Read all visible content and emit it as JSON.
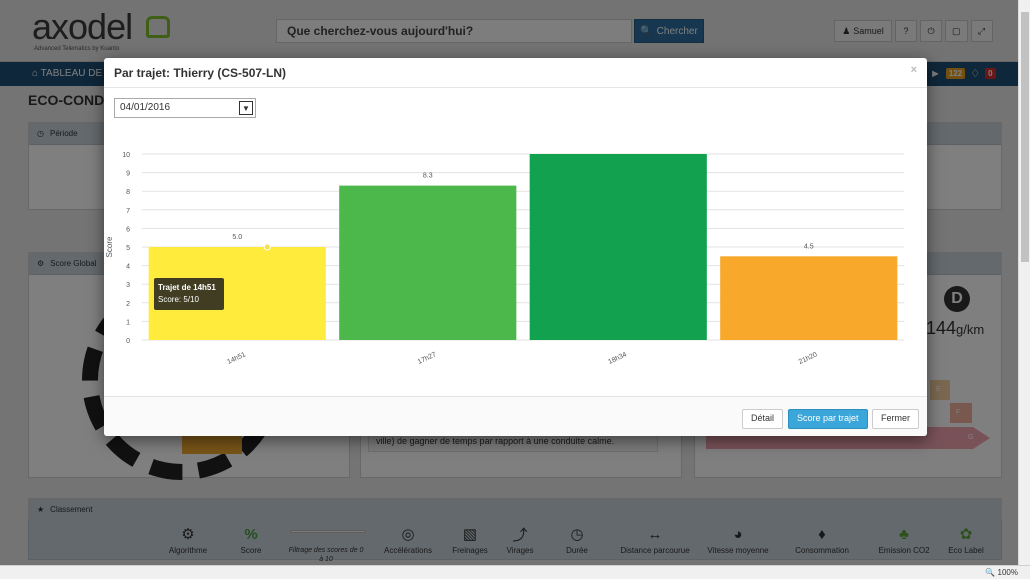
{
  "app": {
    "logo_text": "axodel",
    "logo_sub": "Advanced Telematics by Kuanto",
    "search_placeholder": "Que cherchez-vous aujourd'hui?",
    "search_button": "Chercher",
    "user_name": "Samuel"
  },
  "nav": {
    "home_label": "TABLEAU DE",
    "badge_messages": "122",
    "badge_alerts": "0"
  },
  "page": {
    "title": "ECO-CONDU",
    "panel_periode": "Période",
    "panel_score": "Score Global",
    "panel_classement": "Classement",
    "text_snippet": "ville) de gagner de temps par rapport à une conduite calme.",
    "eco_letter": "D",
    "co2_value": "144",
    "co2_unit": "g/km",
    "arrow_e": "E",
    "arrow_f": "F",
    "arrow_g": "G"
  },
  "ranking": [
    {
      "label": "Algorithme",
      "icon": "algorithm-icon"
    },
    {
      "label": "Score",
      "icon": "percent-icon"
    },
    {
      "label": "Filtrage des scores de 0 à 10",
      "icon": "slider-icon"
    },
    {
      "label": "Accélérations",
      "icon": "steering-icon"
    },
    {
      "label": "Freinages",
      "icon": "barrier-icon"
    },
    {
      "label": "Virages",
      "icon": "curve-icon"
    },
    {
      "label": "Durée",
      "icon": "clock-icon"
    },
    {
      "label": "Distance parcourue",
      "icon": "car-distance-icon"
    },
    {
      "label": "Vitesse moyenne",
      "icon": "speedometer-icon"
    },
    {
      "label": "Consommation",
      "icon": "drop-icon"
    },
    {
      "label": "Emission CO2",
      "icon": "tree-icon"
    },
    {
      "label": "Eco Label",
      "icon": "leaf-icon"
    }
  ],
  "statusbar": {
    "zoom": "100%"
  },
  "modal": {
    "title": "Par trajet: Thierry (CS-507-LN)",
    "close": "×",
    "date": "04/01/2016",
    "tooltip_title": "Trajet de 14h51",
    "tooltip_score": "Score: 5/10",
    "buttons": {
      "detail": "Détail",
      "score_trajet": "Score par trajet",
      "fermer": "Fermer"
    }
  },
  "chart_data": {
    "type": "bar",
    "categories": [
      "14h51",
      "17h27",
      "18h34",
      "21h20"
    ],
    "values": [
      5.0,
      8.3,
      10,
      4.5
    ],
    "data_labels": [
      "5.0",
      "8.3",
      "",
      "4.5"
    ],
    "colors": [
      "#ffeb3b",
      "#4cb84c",
      "#12a14f",
      "#f8a92c"
    ],
    "ylabel": "Score",
    "ylim": [
      0,
      10
    ],
    "yticks": [
      0,
      1,
      2,
      3,
      4,
      5,
      6,
      7,
      8,
      9,
      10
    ],
    "grid": true
  }
}
